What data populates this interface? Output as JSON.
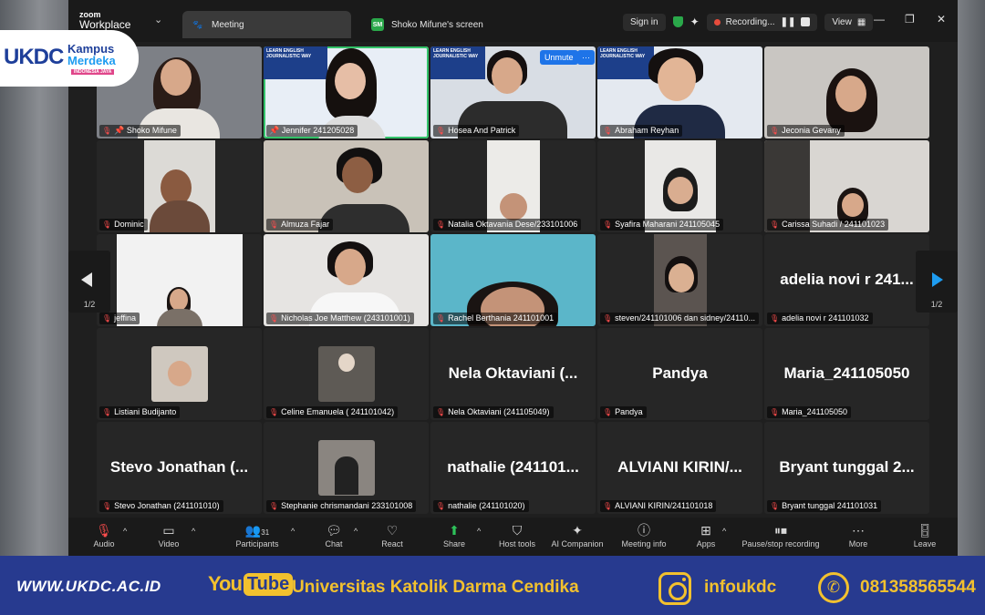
{
  "titlebar": {
    "brand_line1": "zoom",
    "brand_line2": "Workplace",
    "tabs": [
      {
        "label": "Meeting"
      },
      {
        "label": "Shoko Mifune's screen",
        "badge": "SM"
      }
    ],
    "sign_in": "Sign in",
    "recording": "Recording...",
    "view": "View"
  },
  "logo": {
    "left": "UKDC",
    "line1": "Kampus",
    "line2": "Merdeka",
    "line3": "INDONESIA JAYA"
  },
  "video_overlay": {
    "unmute": "Unmute",
    "more": "···"
  },
  "banner_text": "LEARN ENGLISH JOURNALISTIC WAY",
  "participants": [
    {
      "name": "Shoko Mifune",
      "muted": true,
      "video": true
    },
    {
      "name": "Jennifer 241205028",
      "muted": false,
      "video": true,
      "active": true
    },
    {
      "name": "Hosea And Patrick",
      "muted": true,
      "video": true
    },
    {
      "name": "Abraham Reyhan",
      "muted": true,
      "video": true
    },
    {
      "name": "Jeconia Gevany",
      "muted": true,
      "video": true
    },
    {
      "name": "Dominic",
      "muted": true,
      "video": true
    },
    {
      "name": "Almuza Fajar",
      "muted": true,
      "video": true
    },
    {
      "name": "Natalia Oktavania Dese/233101006",
      "muted": true,
      "video": true
    },
    {
      "name": "Syafira Maharani 241105045",
      "muted": true,
      "video": true
    },
    {
      "name": "Carissa Suhadi / 241101023",
      "muted": true,
      "video": true
    },
    {
      "name": "jeffina",
      "muted": true,
      "video": true
    },
    {
      "name": "Nicholas Joe Matthew (243101001)",
      "muted": true,
      "video": true
    },
    {
      "name": "Rachel Berthania 241101001",
      "muted": true,
      "video": true
    },
    {
      "name": "steven/241101006 dan sidney/24110...",
      "muted": true,
      "video": true
    },
    {
      "name": "adelia novi r 241101032",
      "muted": true,
      "video": false,
      "display": "adelia novi r 241..."
    },
    {
      "name": "Listiani Budijanto",
      "muted": true,
      "video": true
    },
    {
      "name": "Celine Emanuela ( 241101042)",
      "muted": true,
      "video": true
    },
    {
      "name": "Nela Oktaviani (241105049)",
      "muted": true,
      "video": false,
      "display": "Nela Oktaviani (..."
    },
    {
      "name": "Pandya",
      "muted": true,
      "video": false,
      "display": "Pandya"
    },
    {
      "name": "Maria_241105050",
      "muted": true,
      "video": false,
      "display": "Maria_241105050"
    },
    {
      "name": "Stevo Jonathan (241101010)",
      "muted": true,
      "video": false,
      "display": "Stevo Jonathan (..."
    },
    {
      "name": "Stephanie chrismandani 233101008",
      "muted": true,
      "video": true
    },
    {
      "name": "nathalie (241101020)",
      "muted": true,
      "video": false,
      "display": "nathalie (241101..."
    },
    {
      "name": "ALVIANI KIRIN/241101018",
      "muted": true,
      "video": false,
      "display": "ALVIANI KIRIN/..."
    },
    {
      "name": "Bryant tunggal 241101031",
      "muted": true,
      "video": false,
      "display": "Bryant tunggal 2..."
    }
  ],
  "pagination": {
    "left": "1/2",
    "right": "1/2"
  },
  "toolbar": {
    "audio": "Audio",
    "video": "Video",
    "participants": "Participants",
    "participants_count": "31",
    "chat": "Chat",
    "react": "React",
    "share": "Share",
    "host_tools": "Host tools",
    "ai_companion": "AI Companion",
    "meeting_info": "Meeting info",
    "apps": "Apps",
    "pause_recording": "Pause/stop recording",
    "more": "More",
    "leave": "Leave"
  },
  "footer": {
    "url": "WWW.UKDC.AC.ID",
    "youtube_you": "You",
    "youtube_tube": "Tube",
    "university": "Universitas Katolik Darma Cendika",
    "instagram": "infoukdc",
    "whatsapp": "081358565544"
  },
  "colors": {
    "accent_blue": "#1e74e8",
    "active_green": "#33c36a",
    "footer_bg": "#273a8f",
    "footer_text": "#f2c12e",
    "muted_red": "#ff4d4d"
  }
}
